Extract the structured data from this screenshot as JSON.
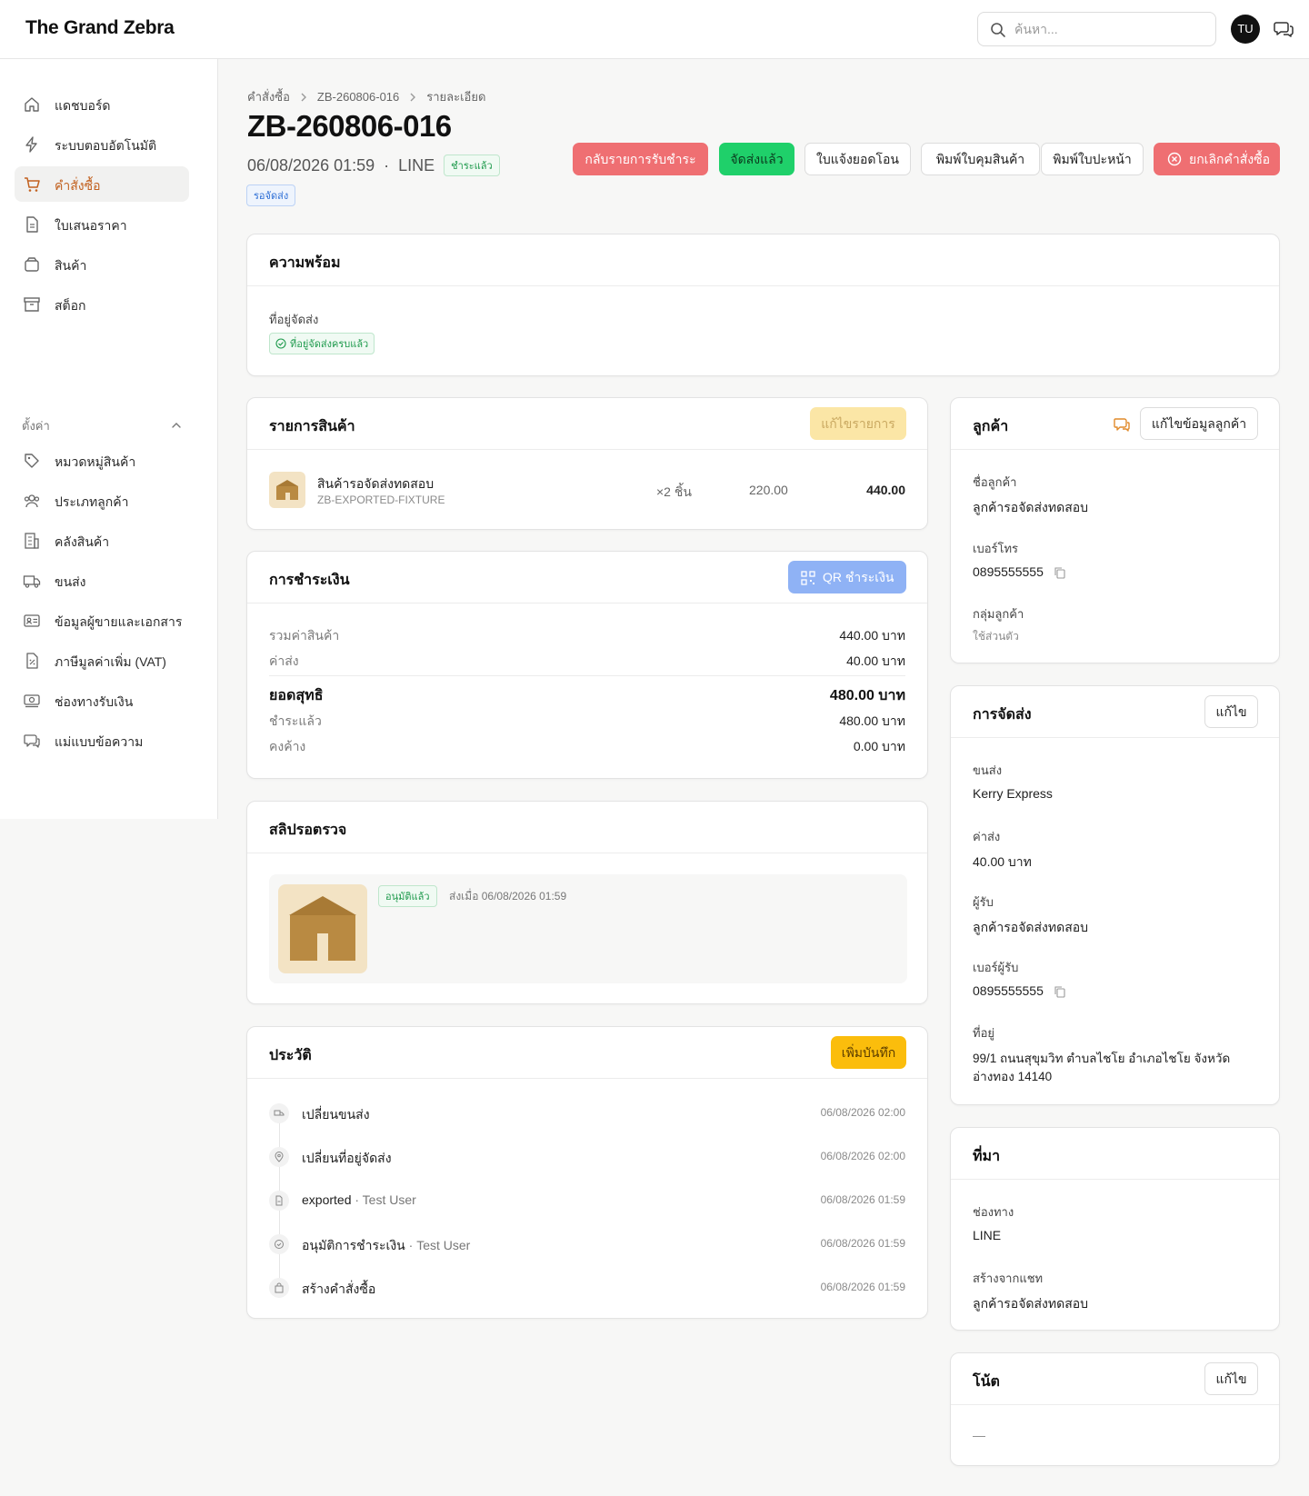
{
  "app": {
    "brand": "The Grand Zebra",
    "search_placeholder": "ค้นหา...",
    "avatar_initials": "TU"
  },
  "sidebar": {
    "items": [
      {
        "label": "แดชบอร์ด",
        "icon": "home-icon",
        "active": false
      },
      {
        "label": "ระบบตอบอัตโนมัติ",
        "icon": "lightning-icon",
        "active": false
      },
      {
        "label": "คำสั่งซื้อ",
        "icon": "cart-icon",
        "active": true
      },
      {
        "label": "ใบเสนอราคา",
        "icon": "document-icon",
        "active": false
      },
      {
        "label": "สินค้า",
        "icon": "box-icon",
        "active": false
      },
      {
        "label": "สต็อก",
        "icon": "archive-icon",
        "active": false
      }
    ],
    "settings_label": "ตั้งค่า",
    "settings_items": [
      {
        "label": "หมวดหมู่สินค้า",
        "icon": "tag-icon"
      },
      {
        "label": "ประเภทลูกค้า",
        "icon": "users-icon"
      },
      {
        "label": "คลังสินค้า",
        "icon": "building-icon"
      },
      {
        "label": "ขนส่ง",
        "icon": "truck-icon"
      },
      {
        "label": "ข้อมูลผู้ขายและเอกสาร",
        "icon": "id-card-icon"
      },
      {
        "label": "ภาษีมูลค่าเพิ่ม (VAT)",
        "icon": "percent-icon"
      },
      {
        "label": "ช่องทางรับเงิน",
        "icon": "money-icon"
      },
      {
        "label": "แม่แบบข้อความ",
        "icon": "chat-icon"
      }
    ]
  },
  "header": {
    "breadcrumb": [
      "คำสั่งซื้อ",
      "ZB-260806-016",
      "รายละเอียด"
    ],
    "order_id": "ZB-260806-016",
    "datetime": "06/08/2026 01:59",
    "channel": "LINE",
    "payment_badge": "ชำระแล้ว",
    "status_badge": "รอจัดส่ง",
    "buttons": {
      "revert_payment": "กลับรายการรับชำระ",
      "shipped": "จัดส่งแล้ว",
      "transfer_notice": "ใบแจ้งยอดโอน",
      "print_packing": "พิมพ์ใบคุมสินค้า",
      "print_cover": "พิมพ์ใบปะหน้า",
      "cancel_order": "ยกเลิกคำสั่งซื้อ"
    }
  },
  "readiness": {
    "title": "ความพร้อม",
    "field": "ที่อยู่จัดส่ง",
    "badge": "ที่อยู่จัดส่งครบแล้ว"
  },
  "items": {
    "title": "รายการสินค้า",
    "edit_button": "แก้ไขรายการ",
    "rows": [
      {
        "name": "สินค้ารอจัดส่งทดสอบ",
        "sku": "ZB-EXPORTED-FIXTURE",
        "qty": "×2 ชิ้น",
        "unit_price": "220.00",
        "total": "440.00"
      }
    ]
  },
  "payment": {
    "title": "การชำระเงิน",
    "qr_button": "QR ชำระเงิน",
    "subtotal_label": "รวมค่าสินค้า",
    "subtotal": "440.00 บาท",
    "shipping_label": "ค่าส่ง",
    "shipping": "40.00 บาท",
    "net_label": "ยอดสุทธิ",
    "net": "480.00 บาท",
    "paid_label": "ชำระแล้ว",
    "paid": "480.00 บาท",
    "due_label": "คงค้าง",
    "due": "0.00 บาท"
  },
  "slips": {
    "title": "สลิปรอตรวจ",
    "badge": "อนุมัติแล้ว",
    "sent_at": "ส่งเมื่อ 06/08/2026 01:59"
  },
  "history": {
    "title": "ประวัติ",
    "add_button": "เพิ่มบันทึก",
    "events": [
      {
        "text": "เปลี่ยนขนส่ง",
        "by": "",
        "time": "06/08/2026 02:00",
        "icon": "truck-icon"
      },
      {
        "text": "เปลี่ยนที่อยู่จัดส่ง",
        "by": "",
        "time": "06/08/2026 02:00",
        "icon": "pin-icon"
      },
      {
        "text": "exported",
        "by": "· Test User",
        "time": "06/08/2026 01:59",
        "icon": "file-icon"
      },
      {
        "text": "อนุมัติการชำระเงิน",
        "by": "· Test User",
        "time": "06/08/2026 01:59",
        "icon": "check-circle-icon"
      },
      {
        "text": "สร้างคำสั่งซื้อ",
        "by": "",
        "time": "06/08/2026 01:59",
        "icon": "bag-icon"
      }
    ]
  },
  "customer": {
    "title": "ลูกค้า",
    "edit_button": "แก้ไขข้อมูลลูกค้า",
    "name_label": "ชื่อลูกค้า",
    "name": "ลูกค้ารอจัดส่งทดสอบ",
    "phone_label": "เบอร์โทร",
    "phone": "0895555555",
    "group_label": "กลุ่มลูกค้า",
    "group": "ใช้ส่วนตัว"
  },
  "shipping": {
    "title": "การจัดส่ง",
    "edit_button": "แก้ไข",
    "carrier_label": "ขนส่ง",
    "carrier": "Kerry Express",
    "fee_label": "ค่าส่ง",
    "fee": "40.00 บาท",
    "recipient_label": "ผู้รับ",
    "recipient": "ลูกค้ารอจัดส่งทดสอบ",
    "recipient_phone_label": "เบอร์ผู้รับ",
    "recipient_phone": "0895555555",
    "address_label": "ที่อยู่",
    "address_line1": "99/1 ถนนสุขุมวิท ตำบลไชโย อำเภอไชโย จังหวัด",
    "address_line2": "อ่างทอง 14140"
  },
  "source": {
    "title": "ที่มา",
    "channel_label": "ช่องทาง",
    "channel": "LINE",
    "chat_label": "สร้างจากแชท",
    "chat": "ลูกค้ารอจัดส่งทดสอบ"
  },
  "notes": {
    "title": "โน้ต",
    "edit_button": "แก้ไข",
    "content": "—"
  },
  "colors": {
    "accent": "#c2611f",
    "danger": "#ef6f72",
    "success": "#1fd06a",
    "amber": "#fbbd0c",
    "blue": "#8fb2f5"
  }
}
